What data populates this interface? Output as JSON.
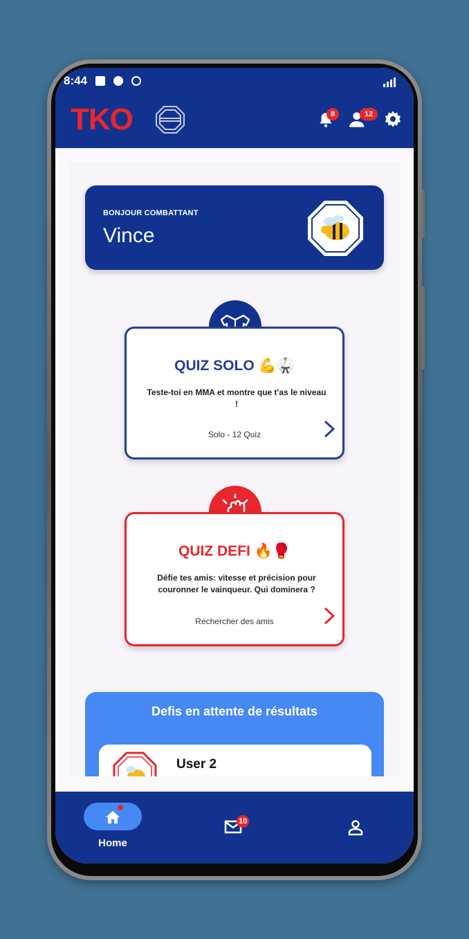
{
  "status_bar": {
    "time": "8:44"
  },
  "app_bar": {
    "logo": "TKO",
    "notifications_count": "8",
    "friends_count": "12"
  },
  "greeting": {
    "label": "BONJOUR COMBATTANT",
    "name": "Vince"
  },
  "quiz_solo": {
    "title": "QUIZ SOLO 💪🥋",
    "description": "Teste-toi en MMA et montre que t'as le niveau !",
    "footer": "Solo - 12 Quiz"
  },
  "quiz_defi": {
    "title": "QUIZ DEFI 🔥🥊",
    "description": "Défie tes amis: vitesse et précision pour couronner le vainqueur. Qui dominera ?",
    "footer": "Rechercher des amis"
  },
  "pending": {
    "title": "Defis en attente de résultats",
    "items": [
      {
        "name": "User 2"
      }
    ]
  },
  "bottom_nav": {
    "home_label": "Home",
    "messages_count": "10"
  },
  "colors": {
    "brand_blue": "#12328f",
    "accent_red": "#e8262b",
    "light_blue": "#4689f5",
    "background": "#417293"
  }
}
